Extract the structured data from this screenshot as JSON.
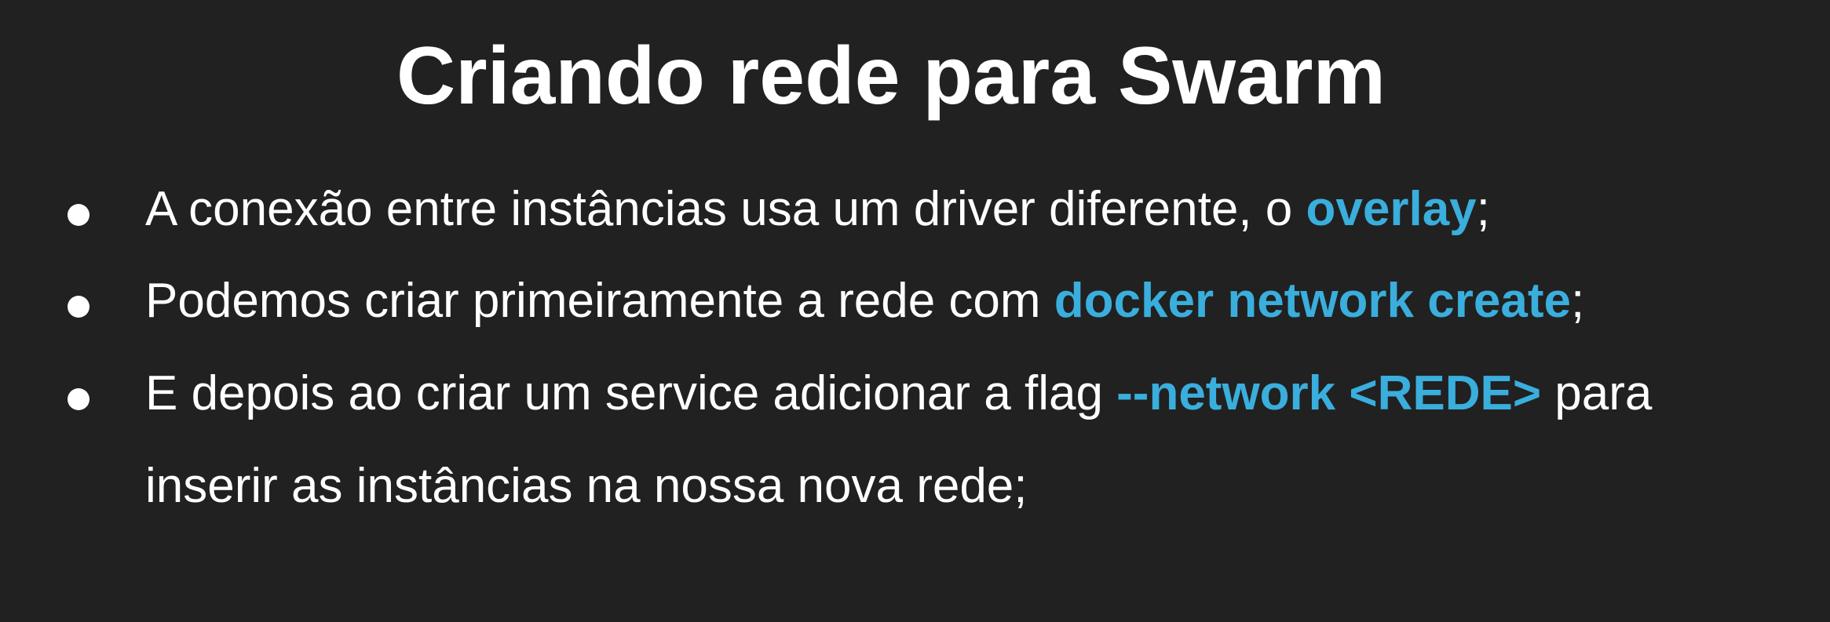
{
  "slide": {
    "title": "Criando rede para Swarm",
    "accent_color": "#3aaedc",
    "background_color": "#212121",
    "bullets": [
      {
        "before": "A conexão entre instâncias usa um driver diferente, o ",
        "highlight": "overlay",
        "after": ";"
      },
      {
        "before": "Podemos criar primeiramente a rede com ",
        "highlight": "docker network create",
        "after": ";"
      },
      {
        "before": "E depois ao criar um service adicionar a flag ",
        "highlight": "--network <REDE>",
        "after": " para",
        "continuation": "inserir as instâncias na nossa nova rede;"
      }
    ]
  }
}
